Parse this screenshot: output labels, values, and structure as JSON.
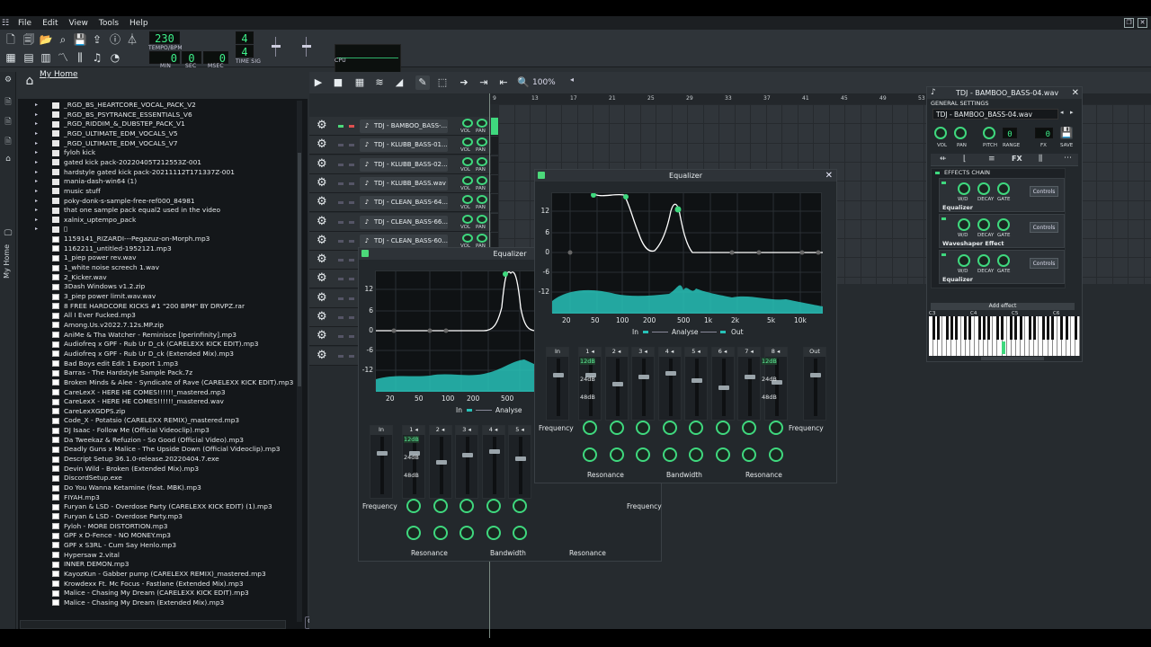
{
  "menu": {
    "items": [
      "File",
      "Edit",
      "View",
      "Tools",
      "Help"
    ]
  },
  "toolbar": {
    "tempo": "230",
    "tempo_label": "TEMPO/BPM",
    "time_min": "0",
    "time_sec": "0",
    "time_msec": "0",
    "min_label": "MIN",
    "sec_label": "SEC",
    "msec_label": "MSEC",
    "timesig_num": "4",
    "timesig_den": "4",
    "timesig_label": "TIME SIG",
    "cpu_label": "CPU"
  },
  "sidebar": {
    "tab_label": "My Home"
  },
  "browser": {
    "title": "My Home",
    "items": [
      {
        "name": "_RGD_BS_HEARTCORE_VOCAL_PACK_V2",
        "type": "folder"
      },
      {
        "name": "_RGD_BS_PSYTRANCE_ESSENTIALS_V6",
        "type": "folder"
      },
      {
        "name": "_RGD_RIDDIM_&_DUBSTEP_PACK_V1",
        "type": "folder"
      },
      {
        "name": "_RGD_ULTIMATE_EDM_VOCALS_V5",
        "type": "folder"
      },
      {
        "name": "_RGD_ULTIMATE_EDM_VOCALS_V7",
        "type": "folder"
      },
      {
        "name": "fyloh kick",
        "type": "folder"
      },
      {
        "name": "gated kick pack-20220405T212553Z-001",
        "type": "folder"
      },
      {
        "name": "hardstyle gated kick pack-20211112T171337Z-001",
        "type": "folder"
      },
      {
        "name": "mania-dash-win64 (1)",
        "type": "folder"
      },
      {
        "name": "music stuff",
        "type": "folder"
      },
      {
        "name": "poky-donk-s-sample-free-ref000_84981",
        "type": "folder"
      },
      {
        "name": "that one sample pack equal2 used in the video",
        "type": "folder"
      },
      {
        "name": "xalnix_uptempo_pack",
        "type": "folder"
      },
      {
        "name": "▯",
        "type": "folder"
      },
      {
        "name": "1159141_RIZARDI---Pegazuz-on-Morph.mp3",
        "type": "file"
      },
      {
        "name": "1162211_untitled-1952121.mp3",
        "type": "file"
      },
      {
        "name": "1_piep power rev.wav",
        "type": "file"
      },
      {
        "name": "1_white noise screech 1.wav",
        "type": "file"
      },
      {
        "name": "2_Kicker.wav",
        "type": "file"
      },
      {
        "name": "3Dash Windows v1.2.zip",
        "type": "file"
      },
      {
        "name": "3_piep power limit.wav.wav",
        "type": "file"
      },
      {
        "name": "8 FREE HARDCORE KICKS #1 \"200 BPM\" BY DRVPZ.rar",
        "type": "file"
      },
      {
        "name": "All I Ever Fucked.mp3",
        "type": "file"
      },
      {
        "name": "Among.Us.v2022.7.12s.MP.zip",
        "type": "file"
      },
      {
        "name": "AniMe & Tha Watcher - Reminisce [Iperinfinity].mp3",
        "type": "file"
      },
      {
        "name": "Audiofreq x GPF - Rub Ur D_ck (CARELEXX KICK EDIT).mp3",
        "type": "file"
      },
      {
        "name": "Audiofreq x GPF - Rub Ur D_ck (Extended Mix).mp3",
        "type": "file"
      },
      {
        "name": "Bad Boys edit Edit 1 Export 1.mp3",
        "type": "file"
      },
      {
        "name": "Barras - The Hardstyle Sample Pack.7z",
        "type": "file"
      },
      {
        "name": "Broken Minds & Alee - Syndicate of Rave (CARELEXX KICK EDIT).mp3",
        "type": "file"
      },
      {
        "name": "CareLexX - HERE HE COMES!!!!!!_mastered.mp3",
        "type": "file"
      },
      {
        "name": "CareLexX - HERE HE COMES!!!!!!_mastered.wav",
        "type": "file"
      },
      {
        "name": "CareLexXGDPS.zip",
        "type": "file"
      },
      {
        "name": "Code_X - Potatsio (CARELEXX REMIX)_mastered.mp3",
        "type": "file"
      },
      {
        "name": "DJ Isaac - Follow Me (Official Videoclip).mp3",
        "type": "file"
      },
      {
        "name": "Da Tweekaz & Refuzion - So Good (Official Video).mp3",
        "type": "file"
      },
      {
        "name": "Deadly Guns x Malice - The Upside Down (Official Videoclip).mp3",
        "type": "file"
      },
      {
        "name": "Descript Setup 36.1.0-release.20220404.7.exe",
        "type": "file"
      },
      {
        "name": "Devin Wild - Broken (Extended Mix).mp3",
        "type": "file"
      },
      {
        "name": "DiscordSetup.exe",
        "type": "file"
      },
      {
        "name": "Do You Wanna Ketamine (feat. MBK).mp3",
        "type": "file"
      },
      {
        "name": "FIYAH.mp3",
        "type": "file"
      },
      {
        "name": "Furyan & LSD - Overdose Party (CARELEXX KICK EDIT) (1).mp3",
        "type": "file"
      },
      {
        "name": "Furyan & LSD - Overdose Party.mp3",
        "type": "file"
      },
      {
        "name": "Fyloh - MORE DISTORTION.mp3",
        "type": "file"
      },
      {
        "name": "GPF x D-Fence - NO MONEY.mp3",
        "type": "file"
      },
      {
        "name": "GPF x S3RL - Cum Say Henlo.mp3",
        "type": "file"
      },
      {
        "name": "Hypersaw 2.vital",
        "type": "file"
      },
      {
        "name": "INNER DEMON.mp3",
        "type": "file"
      },
      {
        "name": "KayozKun - Gabber pump (CARELEXX REMIX)_mastered.mp3",
        "type": "file"
      },
      {
        "name": "Krowdexx Ft. Mc Focus - Fastlane (Extended Mix).mp3",
        "type": "file"
      },
      {
        "name": "Malice - Chasing My Dream (CARELEXX KICK EDIT).mp3",
        "type": "file"
      },
      {
        "name": "Malice - Chasing My Dream (Extended Mix).mp3",
        "type": "file"
      }
    ]
  },
  "song_editor": {
    "zoom": "100%",
    "bar_numbers": [
      "9",
      "13",
      "17",
      "21",
      "25",
      "29",
      "33",
      "37",
      "41",
      "45",
      "49",
      "53",
      "57",
      "61",
      "65"
    ],
    "tracks": [
      {
        "name": "TDJ - BAMBOO_BASS-..."
      },
      {
        "name": "TDJ - KLUBB_BASS-01..."
      },
      {
        "name": "TDJ - KLUBB_BASS-02..."
      },
      {
        "name": "TDJ - KLUBB_BASS.wav"
      },
      {
        "name": "TDJ - CLEAN_BASS-64..."
      },
      {
        "name": "TDJ - CLEAN_BASS-66..."
      },
      {
        "name": "TDJ - CLEAN_BASS-60..."
      },
      {
        "name": ""
      },
      {
        "name": ""
      },
      {
        "name": ""
      },
      {
        "name": ""
      },
      {
        "name": ""
      },
      {
        "name": ""
      }
    ],
    "vol_label": "VOL",
    "pan_label": "PAN"
  },
  "eq_front": {
    "title": "Equalizer",
    "db_ticks": [
      "12",
      "6",
      "0",
      "-6",
      "-12"
    ],
    "freq_ticks": [
      "20",
      "50",
      "100",
      "200",
      "500",
      "1k",
      "2k",
      "5k",
      "10k"
    ],
    "in_label": "In",
    "analyse_label": "Analyse",
    "out_label": "Out",
    "band_in": "In",
    "band_out": "Out",
    "bands": [
      "1",
      "2",
      "3",
      "4",
      "5",
      "6",
      "7",
      "8"
    ],
    "gain_labels": [
      "12dB",
      "24dB",
      "48dB"
    ],
    "frequency_label": "Frequency",
    "resonance_label": "Resonance",
    "bandwidth_label": "Bandwidth"
  },
  "eq_back": {
    "title": "Equalizer",
    "db_ticks": [
      "12",
      "6",
      "0",
      "-6",
      "-12"
    ],
    "freq_ticks": [
      "20",
      "50",
      "100",
      "200",
      "500"
    ],
    "in_label": "In",
    "analyse_label": "Analyse",
    "band_in": "In",
    "bands": [
      "1",
      "2",
      "3",
      "4",
      "5"
    ],
    "gain_labels": [
      "12dB",
      "24dB",
      "48dB"
    ],
    "frequency_label": "Frequency",
    "resonance_label": "Resonance",
    "bandwidth_label": "Bandwidth"
  },
  "instrument": {
    "title": "TDJ - BAMBOO_BASS-04.wav",
    "general_label": "GENERAL SETTINGS",
    "name_field": "TDJ - BAMBOO_BASS-04.wav",
    "knob_labels": [
      "VOL",
      "PAN",
      "PITCH",
      "RANGE",
      "FX",
      "SAVE"
    ],
    "pitch_range": "0",
    "fx_channel": "0",
    "effects_chain_label": "EFFECTS CHAIN",
    "effects": [
      {
        "name": "Equalizer"
      },
      {
        "name": "Waveshaper Effect"
      },
      {
        "name": "Equalizer"
      }
    ],
    "effect_knobs": [
      "W/D",
      "DECAY",
      "GATE"
    ],
    "controls_label": "Controls",
    "add_effect": "Add effect",
    "octave_labels": [
      "C3",
      "C4",
      "C5",
      "C6"
    ]
  },
  "colors": {
    "accent": "#3fd87e",
    "background": "#2a2f33",
    "analyzer": "#27c2b8"
  }
}
